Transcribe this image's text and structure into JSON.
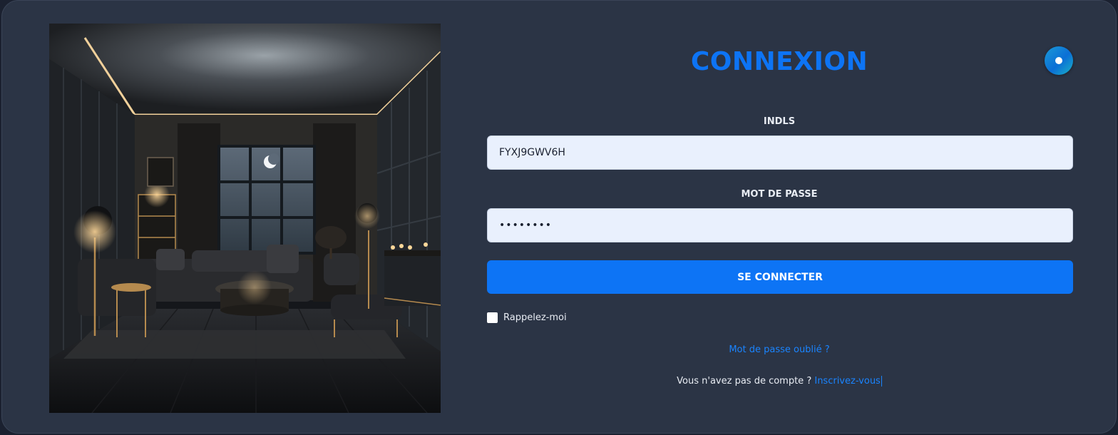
{
  "login": {
    "title": "CONNEXION",
    "username": {
      "label": "INDLS",
      "value": "FYXJ9GWV6H"
    },
    "password": {
      "label": "MOT DE PASSE",
      "value": "••••••••"
    },
    "submit_label": "SE CONNECTER",
    "remember_label": "Rappelez-moi",
    "remember_checked": false,
    "forgot_label": "Mot de passe oublié ?",
    "signup_prompt": "Vous n'avez pas de compte ?",
    "signup_link": "Inscrivez-vous"
  },
  "theme": {
    "accent": "#0d74f5",
    "card_bg": "#2b3445",
    "page_bg": "#1b2130",
    "input_bg": "#e9f0fd"
  },
  "icons": {
    "theme_toggle": "theme-toggle-icon",
    "illustration": "living-room-illustration"
  }
}
